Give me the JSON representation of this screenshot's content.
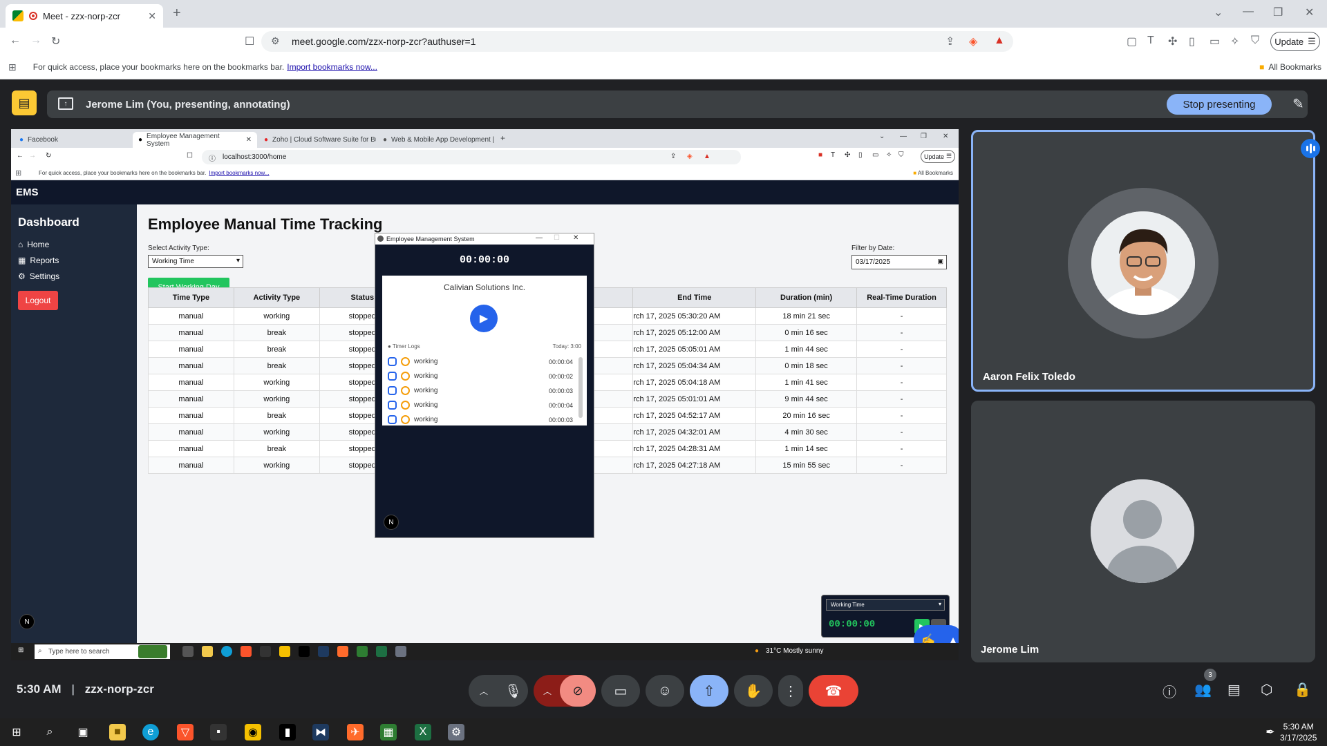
{
  "browser": {
    "tab_title": "Meet - zzx-norp-zcr",
    "url": "meet.google.com/zzx-norp-zcr?authuser=1",
    "update_label": "Update",
    "bookmarks_hint": "For quick access, place your bookmarks here on the bookmarks bar.",
    "import_link": "Import bookmarks now...",
    "all_bookmarks": "All Bookmarks"
  },
  "meet": {
    "presenting_label": "Jerome Lim (You, presenting, annotating)",
    "stop_presenting": "Stop presenting",
    "time": "5:30 AM",
    "meeting_code": "zzx-norp-zcr",
    "people_count": "3",
    "participants": [
      {
        "name": "Aaron Felix Toledo"
      },
      {
        "name": "Jerome Lim"
      }
    ]
  },
  "shared": {
    "tabs": [
      "Facebook",
      "Employee Management System",
      "Zoho | Cloud Software Suite for Bu",
      "Web & Mobile App Development |"
    ],
    "url": "localhost:3000/home",
    "update_label": "Update",
    "bookmarks_hint": "For quick access, place your bookmarks here on the bookmarks bar.",
    "import_link": "Import bookmarks now...",
    "all_bookmarks": "All Bookmarks",
    "app_name": "EMS",
    "sidebar": {
      "title": "Dashboard",
      "items": [
        "Home",
        "Reports",
        "Settings"
      ],
      "logout": "Logout"
    },
    "page_title": "Employee Manual Time Tracking",
    "activity_label": "Select Activity Type:",
    "activity_value": "Working Time",
    "start_button": "Start Working Day",
    "filter_label": "Filter by Date:",
    "filter_value": "03/17/2025",
    "table": {
      "headers": [
        "Time Type",
        "Activity Type",
        "Status",
        "End Time",
        "Duration (min)",
        "Real-Time Duration"
      ],
      "rows": [
        [
          "manual",
          "working",
          "stopped",
          "rch 17, 2025 05:30:20 AM",
          "18 min 21 sec",
          "-"
        ],
        [
          "manual",
          "break",
          "stopped",
          "rch 17, 2025 05:12:00 AM",
          "0 min 16 sec",
          "-"
        ],
        [
          "manual",
          "break",
          "stopped",
          "rch 17, 2025 05:05:01 AM",
          "1 min 44 sec",
          "-"
        ],
        [
          "manual",
          "break",
          "stopped",
          "rch 17, 2025 05:04:34 AM",
          "0 min 18 sec",
          "-"
        ],
        [
          "manual",
          "working",
          "stopped",
          "rch 17, 2025 05:04:18 AM",
          "1 min 41 sec",
          "-"
        ],
        [
          "manual",
          "working",
          "stopped",
          "rch 17, 2025 05:01:01 AM",
          "9 min 44 sec",
          "-"
        ],
        [
          "manual",
          "break",
          "stopped",
          "rch 17, 2025 04:52:17 AM",
          "20 min 16 sec",
          "-"
        ],
        [
          "manual",
          "working",
          "stopped",
          "rch 17, 2025 04:32:01 AM",
          "4 min 30 sec",
          "-"
        ],
        [
          "manual",
          "break",
          "stopped",
          "rch 17, 2025 04:28:31 AM",
          "1 min 14 sec",
          "-"
        ],
        [
          "manual",
          "working",
          "stopped",
          "rch 17, 2025 04:27:18 AM",
          "15 min 55 sec",
          "-"
        ]
      ]
    },
    "popup": {
      "title": "Employee Management System",
      "timer": "00:00:00",
      "company": "Calivian Solutions Inc.",
      "logs_label": "Timer Logs",
      "today_label": "Today: 3:00",
      "logs": [
        {
          "activity": "working",
          "duration": "00:00:04"
        },
        {
          "activity": "working",
          "duration": "00:00:02"
        },
        {
          "activity": "working",
          "duration": "00:00:03"
        },
        {
          "activity": "working",
          "duration": "00:00:04"
        },
        {
          "activity": "working",
          "duration": "00:00:03"
        }
      ],
      "badge": "N"
    },
    "mini_widget": {
      "select_value": "Working Time",
      "timer": "00:00:00"
    },
    "side_badge": "N",
    "taskbar": {
      "search_placeholder": "Type here to search",
      "weather": "31°C  Mostly sunny"
    }
  },
  "taskbar": {
    "time": "5:30 AM",
    "date": "3/17/2025"
  }
}
